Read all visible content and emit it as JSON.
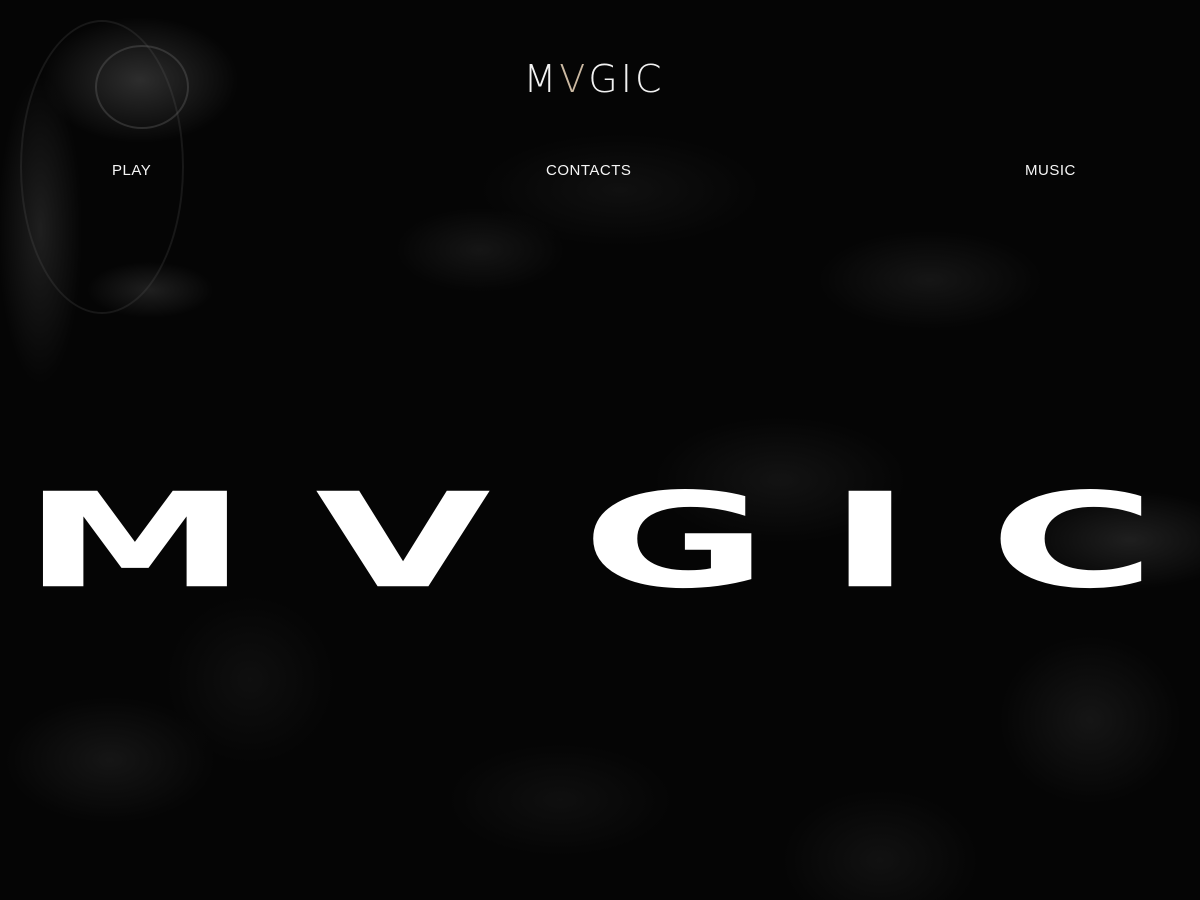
{
  "header": {
    "logo_left": "M",
    "logo_v": "V",
    "logo_right": "GIC",
    "logo_accent_color": "#cbb9a2"
  },
  "nav": {
    "items": [
      {
        "label": "PLAY"
      },
      {
        "label": "CONTACTS"
      },
      {
        "label": "MUSIC"
      }
    ]
  },
  "hero": {
    "letters": [
      "M",
      "V",
      "G",
      "I",
      "C"
    ]
  },
  "theme": {
    "background": "#000000",
    "text": "#ffffff"
  }
}
